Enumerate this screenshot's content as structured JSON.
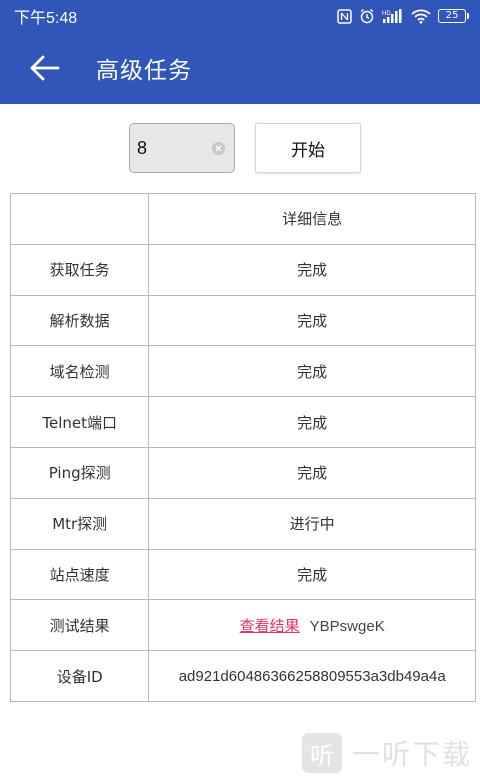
{
  "status_bar": {
    "time": "下午5:48",
    "battery": "25"
  },
  "app_bar": {
    "title": "高级任务"
  },
  "controls": {
    "task_count_value": "8",
    "start_label": "开始"
  },
  "table": {
    "header": {
      "label": "",
      "value": "详细信息"
    },
    "rows": [
      {
        "label": "获取任务",
        "value": "完成"
      },
      {
        "label": "解析数据",
        "value": "完成"
      },
      {
        "label": "域名检测",
        "value": "完成"
      },
      {
        "label": "Telnet端口",
        "value": "完成"
      },
      {
        "label": "Ping探测",
        "value": "完成"
      },
      {
        "label": "Mtr探测",
        "value": "进行中"
      },
      {
        "label": "站点速度",
        "value": "完成"
      }
    ],
    "result_row": {
      "label": "测试结果",
      "link": "查看结果",
      "code": "YBPswgeK"
    },
    "device_row": {
      "label": "设备ID",
      "value": "ad921d60486366258809553a3db49a4a"
    }
  },
  "watermark": {
    "logo_char": "听",
    "text": "一听下载"
  }
}
